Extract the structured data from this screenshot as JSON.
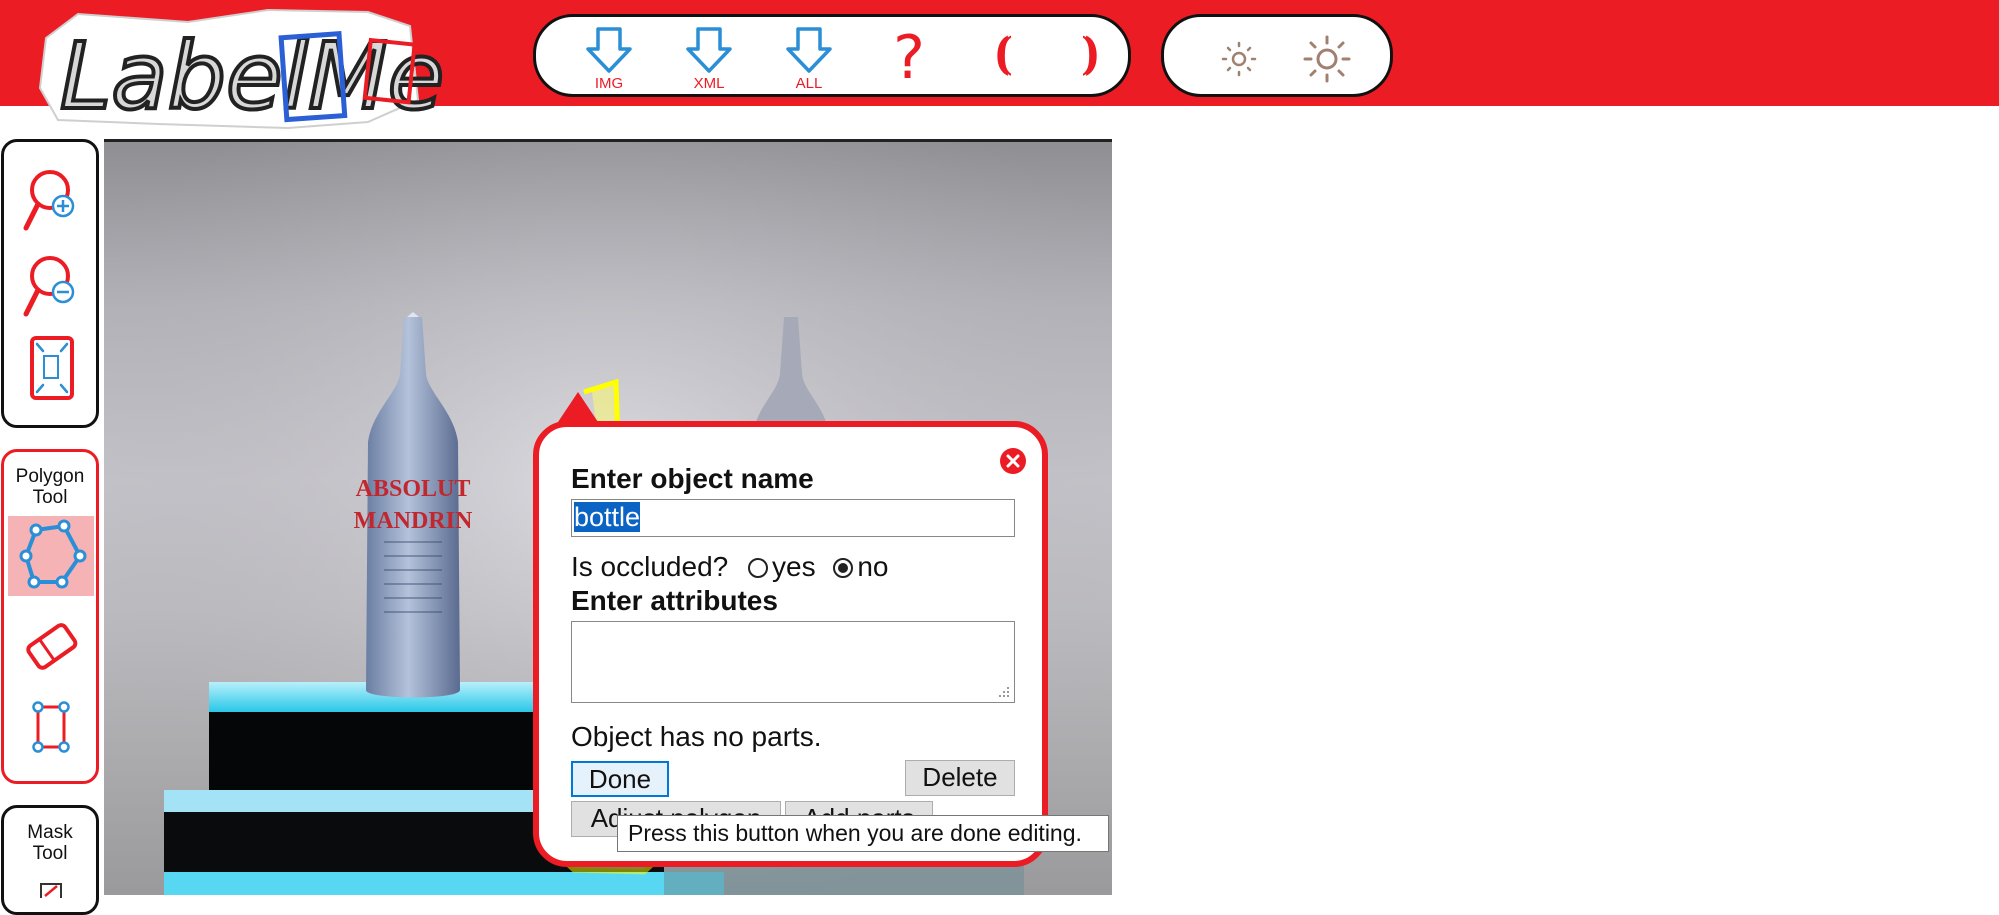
{
  "app": {
    "logo_text": "LabelMe"
  },
  "toolbar": {
    "download_img_label": "IMG",
    "download_xml_label": "XML",
    "download_all_label": "ALL",
    "help_label": "?",
    "prev_label": "((",
    "next_label": "))"
  },
  "sidebar": {
    "polygon_tool_title_1": "Polygon",
    "polygon_tool_title_2": "Tool",
    "mask_tool_title_1": "Mask",
    "mask_tool_title_2": "Tool"
  },
  "canvas": {
    "bottle_brand": "ABSOLUT",
    "bottle_flavor": "MANDRIN"
  },
  "popup": {
    "name_heading": "Enter object name",
    "name_value": "bottle",
    "occluded_label": "Is occluded?",
    "occluded_yes": "yes",
    "occluded_no": "no",
    "occluded_selected": "no",
    "attributes_heading": "Enter attributes",
    "attributes_value": "",
    "parts_status": "Object has no parts.",
    "done_label": "Done",
    "delete_label": "Delete",
    "adjust_label": "Adjust polygon",
    "add_parts_label": "Add parts"
  },
  "tooltip": {
    "text": "Press this button when you are done editing."
  },
  "colors": {
    "brand_red": "#ec1c24",
    "icon_blue": "#2a8fd6",
    "selection_blue": "#0b63c4",
    "highlight_yellow": "#ffff00"
  }
}
